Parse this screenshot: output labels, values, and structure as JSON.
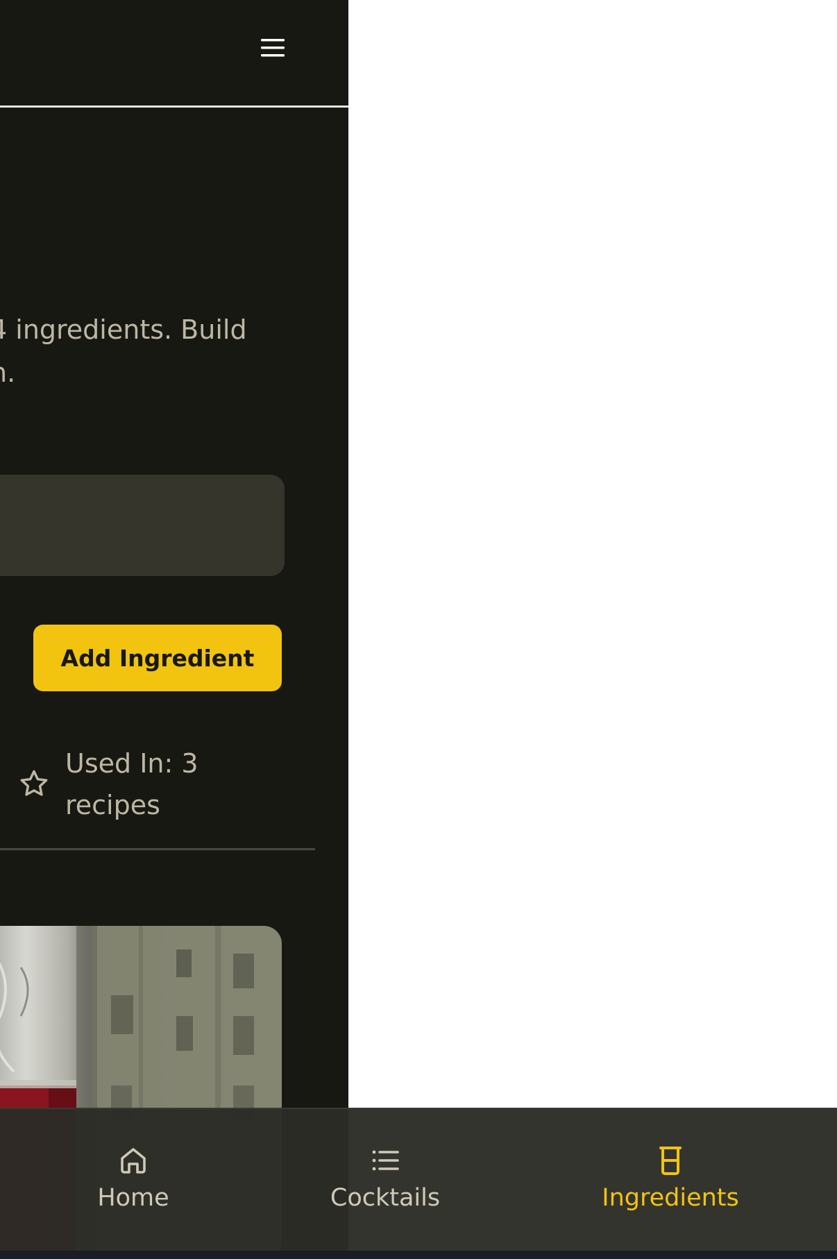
{
  "description": "4 ingredients. Build\nn.",
  "search": {
    "value": "",
    "placeholder": ""
  },
  "actions": {
    "add_ingredient_label": "Add Ingredient"
  },
  "ingredient": {
    "used_in_text": "Used In: 3 recipes",
    "favorite_icon": "star-outline-icon"
  },
  "bottom_nav": {
    "items": [
      {
        "label": "Home",
        "icon": "home-icon",
        "active": false
      },
      {
        "label": "Cocktails",
        "icon": "list-icon",
        "active": false
      },
      {
        "label": "Ingredients",
        "icon": "beaker-icon",
        "active": true
      }
    ]
  },
  "colors": {
    "background": "#181813",
    "accent": "#f2c40f",
    "muted_text": "#bdb7a3",
    "input_bg": "#36352b",
    "nav_bg": "#2c2c26"
  }
}
